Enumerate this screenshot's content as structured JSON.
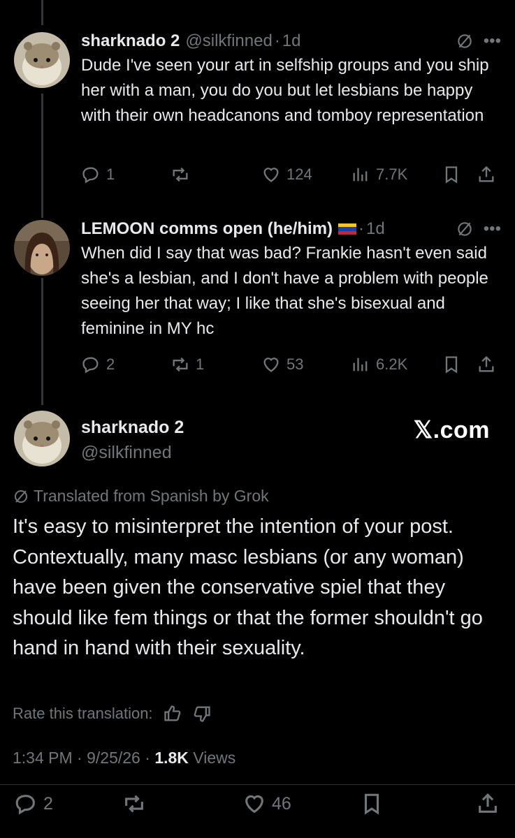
{
  "replies": [
    {
      "name": "sharknado 2",
      "handle": "@silkfinned",
      "time": "1d",
      "text": "Dude I've seen your art in selfship groups and you ship her with a man, you do you but let lesbians be happy with their own headcanons and tomboy representation",
      "stats": {
        "replies": "1",
        "reposts": "",
        "likes": "124",
        "views": "7.7K"
      }
    },
    {
      "name": "LEMOON comms open (he/him)",
      "handle": "",
      "time": "1d",
      "text": "When did I say that was bad? Frankie hasn't even said she's a lesbian, and I don't have a problem with people seeing her that way; I like that she's bisexual and feminine in MY hc",
      "stats": {
        "replies": "2",
        "reposts": "1",
        "likes": "53",
        "views": "6.2K"
      }
    }
  ],
  "main": {
    "name": "sharknado 2",
    "handle": "@silkfinned",
    "watermark": "𝕏.com",
    "translated_label": "Translated from Spanish by Grok",
    "text": "It's easy to misinterpret the intention of your post. Contextually, many masc lesbians (or any woman) have been given the conservative spiel that they should like fem things or that the former shouldn't go hand in hand with their sexuality.",
    "rate_label": "Rate this translation:",
    "time": "1:34 PM",
    "date": "9/25/26",
    "views_count": "1.8K",
    "views_label": "Views",
    "stats": {
      "replies": "2",
      "likes": "46"
    }
  },
  "icons": {
    "reply": "reply-icon",
    "repost": "repost-icon",
    "like": "heart-icon",
    "views": "views-icon",
    "bookmark": "bookmark-icon",
    "share": "share-icon",
    "more": "more-icon",
    "translate": "translate-icon",
    "flag": "venezuela-flag-icon"
  },
  "colors": {
    "background": "#000000",
    "text": "#e7e9ea",
    "muted": "#71767b"
  }
}
